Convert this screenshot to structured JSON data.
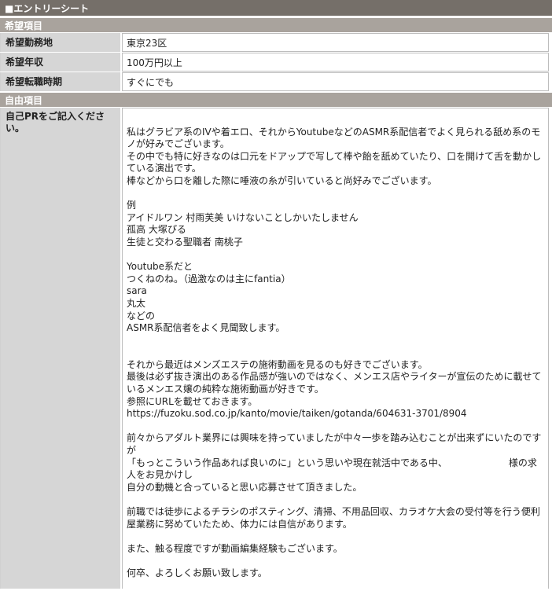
{
  "title": "■エントリーシート",
  "sections": {
    "desired": "希望項目",
    "free": "自由項目"
  },
  "fields": [
    {
      "label": "希望勤務地",
      "value": "東京23区"
    },
    {
      "label": "希望年収",
      "value": "100万円以上"
    },
    {
      "label": "希望転職時期",
      "value": "すぐにでも"
    }
  ],
  "pr": {
    "label": "自己PRをご記入ください。",
    "lines": [
      "　　　`　　　　　　　　　　　　　　　　　　　　　　　　　　",
      "",
      "私はグラビア系のIVや着エロ、それからYoutubeなどのASMR系配信者でよく見られる舐め系のモノが好みでございます。",
      "その中でも特に好きなのは口元をドアップで写して棒や飴を舐めていたり、口を開けて舌を動かしている演出です。",
      "棒などから口を離した際に唾液の糸が引いていると尚好みでございます。",
      "",
      "例",
      "アイドルワン 村雨芙美 いけないことしかいたしません",
      "孤高 大塚ぴる",
      "生徒と交わる聖職者 南桃子",
      "",
      "Youtube系だと",
      "つくねのね。（過激なのは主にfantia）",
      "sara",
      "丸太",
      "などの",
      "ASMR系配信者をよく見聞致します。",
      "",
      "",
      "それから最近はメンズエステの施術動画を見るのも好きでございます。",
      "最後は必ず抜き演出のある作品感が強いのではなく、メンエス店やライターが宣伝のために載せているメンエス嬢の純粋な施術動画が好きです。",
      "参照にURLを載せておきます。",
      "https://fuzoku.sod.co.jp/kanto/movie/taiken/gotanda/604631-3701/8904",
      "",
      "前々からアダルト業界には興味を持っていましたが中々一歩を踏み込むことが出来ずにいたのですが",
      "「もっとこういう作品あれば良いのに」という思いや現在就活中である中、　　　　　　　様の求人をお見かけし",
      "自分の動機と合っていると思い応募させて頂きました。",
      "",
      "前職では徒歩によるチラシのポスティング、清掃、不用品回収、カラオケ大会の受付等を行う便利屋業務に努めていたため、体力には自信があります。",
      "",
      "また、触る程度ですが動画編集経験もございます。",
      "",
      "何卒、よろしくお願い致します。"
    ]
  }
}
